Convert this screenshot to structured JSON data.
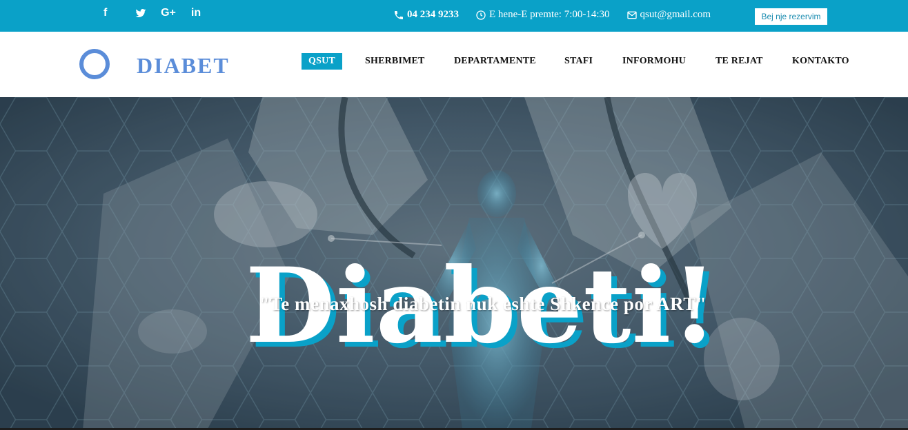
{
  "topbar": {
    "social": [
      {
        "icon": "facebook-icon",
        "glyph": "f"
      },
      {
        "icon": "twitter-icon",
        "glyph": ""
      },
      {
        "icon": "google-plus-icon",
        "glyph": "G+"
      },
      {
        "icon": "linkedin-icon",
        "glyph": "in"
      }
    ],
    "phone": "04 234 9233",
    "hours": "E hene-E premte: 7:00-14:30",
    "email": "qsut@gmail.com",
    "reserve_label": "Bej nje rezervim",
    "bar_color": "#0aa1c8"
  },
  "brand": {
    "name": "DIABET",
    "color": "#5b8dd9"
  },
  "nav": {
    "items": [
      {
        "label": "QSUT",
        "active": true
      },
      {
        "label": "SHERBIMET",
        "active": false
      },
      {
        "label": "DEPARTAMENTE",
        "active": false
      },
      {
        "label": "STAFI",
        "active": false
      },
      {
        "label": "INFORMOHU",
        "active": false
      },
      {
        "label": "TE REJAT",
        "active": false
      },
      {
        "label": "KONTAKTO",
        "active": false
      }
    ],
    "accent": "#0aa1c8"
  },
  "hero": {
    "title": "Diabeti!",
    "quote": "\"Te menaxhosh diabetin nuk eshte Shkence por ART\""
  }
}
